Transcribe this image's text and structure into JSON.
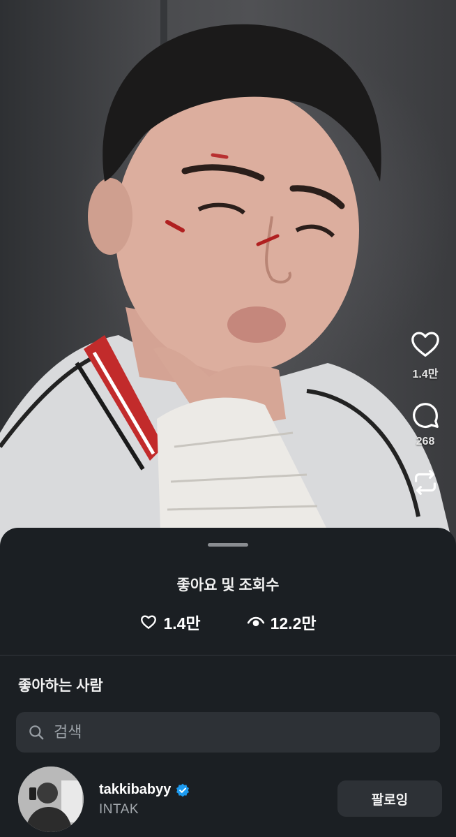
{
  "rail": {
    "like_count": "1.4만",
    "comment_count": "268"
  },
  "sheet": {
    "title": "좋아요 및 조회수",
    "likes": "1.4만",
    "views": "12.2만",
    "section_title": "좋아하는 사람",
    "search_placeholder": "검색"
  },
  "user": {
    "username": "takkibabyy",
    "display_name": "INTAK",
    "verified": true,
    "follow_label": "팔로잉"
  },
  "icons": [
    "heart-icon",
    "comment-icon",
    "repost-icon",
    "eye-icon",
    "search-icon",
    "verified-badge-icon"
  ],
  "colors": {
    "sheet_bg": "#1b1f23",
    "field_bg": "#2d3136",
    "verified_blue": "#1d9bf0",
    "muted_text": "#a4a9ae"
  }
}
